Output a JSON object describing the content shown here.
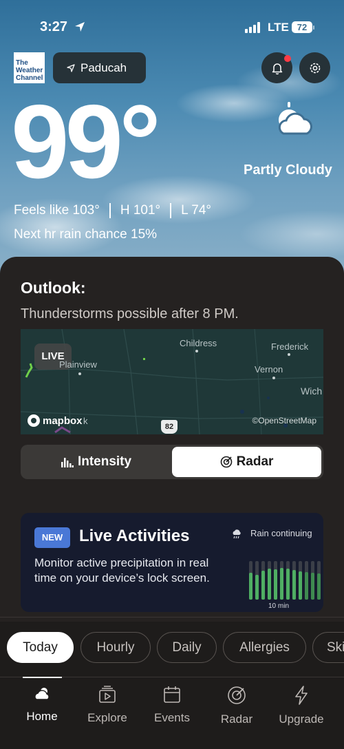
{
  "status_bar": {
    "time": "3:27",
    "network": "LTE",
    "battery": "72"
  },
  "header": {
    "logo_line1": "The",
    "logo_line2": "Weather",
    "logo_line3": "Channel",
    "location": "Paducah"
  },
  "current": {
    "temperature": "99°",
    "condition": "Partly Cloudy",
    "feels_like": "Feels like 103°",
    "high": "H 101°",
    "low": "L 74°",
    "rain_chance": "Next hr rain chance 15%"
  },
  "outlook": {
    "title": "Outlook:",
    "text": "Thunderstorms possible after 8 PM.",
    "map": {
      "live_label": "LIVE",
      "cities": [
        "Childress",
        "Frederick",
        "Plainview",
        "Vernon",
        "Wich",
        "k"
      ],
      "attribution_brand": "mapbox",
      "attribution": "©OpenStreetMap",
      "route_shield": "82"
    },
    "toggle": {
      "intensity_label": "Intensity",
      "radar_label": "Radar",
      "selected": "Radar"
    }
  },
  "live_activities": {
    "badge": "NEW",
    "title": "Live Activities",
    "description": "Monitor active precipitation in real time on your device’s lock screen.",
    "preview_text": "Rain continuing",
    "preview_time": "10 min"
  },
  "chips": [
    {
      "label": "Today",
      "active": true
    },
    {
      "label": "Hourly",
      "active": false
    },
    {
      "label": "Daily",
      "active": false
    },
    {
      "label": "Allergies",
      "active": false
    },
    {
      "label": "Ski",
      "active": false
    }
  ],
  "nav": [
    {
      "label": "Home",
      "icon": "cloud-icon",
      "active": true
    },
    {
      "label": "Explore",
      "icon": "play-stack-icon",
      "active": false
    },
    {
      "label": "Events",
      "icon": "calendar-icon",
      "active": false
    },
    {
      "label": "Radar",
      "icon": "radar-icon",
      "active": false
    },
    {
      "label": "Upgrade",
      "icon": "bolt-icon",
      "active": false
    }
  ],
  "colors": {
    "panel": "#252221",
    "card": "#161b2e",
    "new_badge": "#4a78d6",
    "notification_dot": "#ff3b46",
    "radar_bar": "#4fae63"
  }
}
